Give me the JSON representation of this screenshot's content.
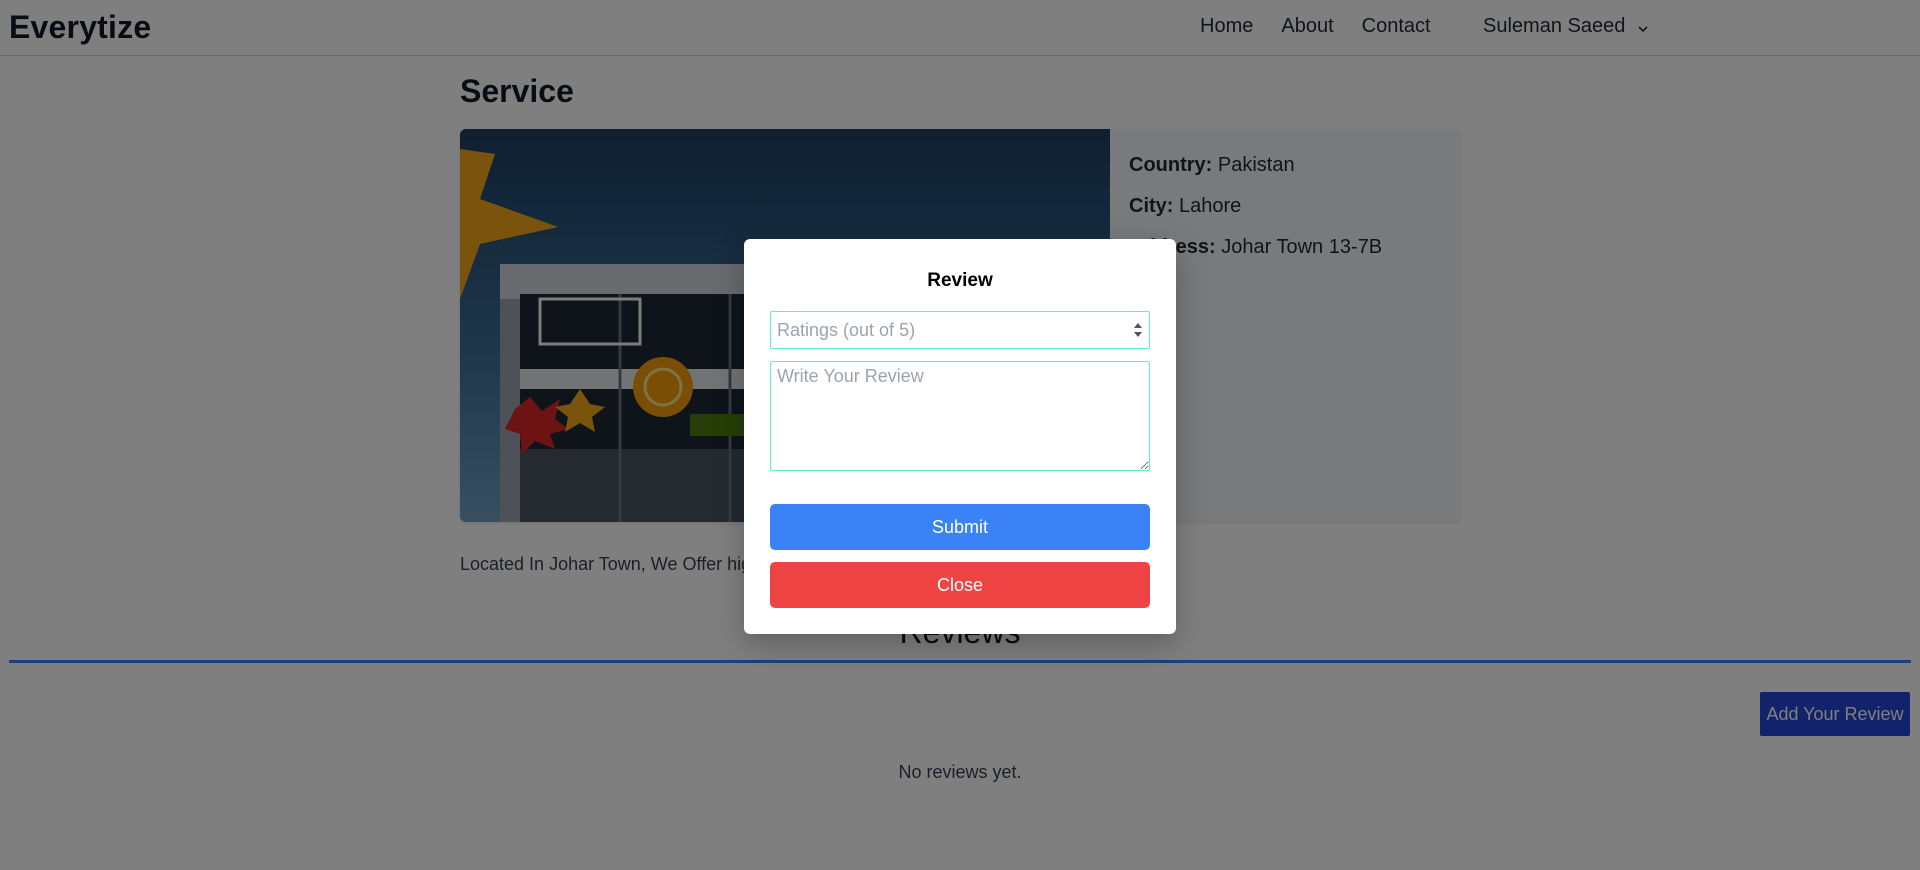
{
  "navbar": {
    "brand": "Everytize",
    "links": [
      "Home",
      "About",
      "Contact"
    ],
    "user_name": "Suleman Saeed",
    "user_menu_icon": "chevron-down-icon"
  },
  "page": {
    "title": "Service",
    "details": [
      {
        "key": "Country:",
        "value": "Pakistan"
      },
      {
        "key": "City:",
        "value": "Lahore"
      },
      {
        "key": "Address:",
        "value": "Johar Town 13-7B"
      }
    ],
    "description_visible": "Located In Johar Town, We Offer hig"
  },
  "reviews": {
    "title": "Reviews",
    "add_button": "Add Your Review",
    "empty_text": "No reviews yet."
  },
  "modal": {
    "title": "Review",
    "rating_placeholder": "Ratings (out of 5)",
    "review_placeholder": "Write Your Review",
    "submit_label": "Submit",
    "close_label": "Close"
  },
  "colors": {
    "accent": "#3b82f6",
    "add_review_button": "#2447d6",
    "close_button": "#ef4444",
    "input_border": "#5eead4"
  }
}
